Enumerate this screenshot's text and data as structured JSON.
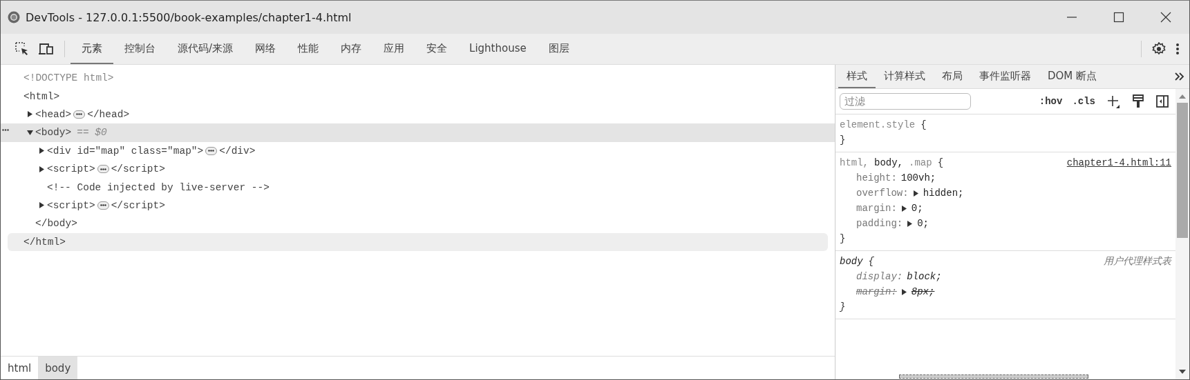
{
  "window": {
    "title": "DevTools - 127.0.0.1:5500/book-examples/chapter1-4.html"
  },
  "main_tabs": [
    {
      "label": "元素",
      "selected": true
    },
    {
      "label": "控制台",
      "selected": false
    },
    {
      "label": "源代码/来源",
      "selected": false
    },
    {
      "label": "网络",
      "selected": false
    },
    {
      "label": "性能",
      "selected": false
    },
    {
      "label": "内存",
      "selected": false
    },
    {
      "label": "应用",
      "selected": false
    },
    {
      "label": "安全",
      "selected": false
    },
    {
      "label": "Lighthouse",
      "selected": false
    },
    {
      "label": "图层",
      "selected": false
    }
  ],
  "dom_tree": [
    {
      "kind": "doctype",
      "text": "<!DOCTYPE html>"
    },
    {
      "kind": "element",
      "open": "<html>",
      "selected": false,
      "closing": "</html>",
      "closing_hovered": true,
      "children": [
        {
          "kind": "element",
          "open": "<head>",
          "close": "</head>",
          "expanded": false,
          "selected": false
        },
        {
          "kind": "element",
          "open": "<body>",
          "note": "== $0",
          "expanded": true,
          "selected": true,
          "closing": "</body>",
          "closing_hovered": false,
          "children": [
            {
              "kind": "element",
              "open": "<div id=\"map\" class=\"map\">",
              "close": "</div>",
              "expanded": false,
              "selected": false
            },
            {
              "kind": "element",
              "open": "<script>",
              "close": "</script>",
              "expanded": false,
              "selected": false
            },
            {
              "kind": "comment",
              "text": "<!-- Code injected by live-server -->"
            },
            {
              "kind": "element",
              "open": "<script>",
              "close": "</script>",
              "expanded": false,
              "selected": false
            }
          ]
        }
      ]
    }
  ],
  "breadcrumbs": [
    {
      "label": "html",
      "selected": false
    },
    {
      "label": "body",
      "selected": true
    }
  ],
  "styles_tabs": [
    {
      "label": "样式",
      "selected": true
    },
    {
      "label": "计算样式",
      "selected": false
    },
    {
      "label": "布局",
      "selected": false
    },
    {
      "label": "事件监听器",
      "selected": false
    },
    {
      "label": "DOM 断点",
      "selected": false
    }
  ],
  "filter": {
    "placeholder": "过滤"
  },
  "filter_buttons": [
    ":hov",
    ".cls"
  ],
  "rules": [
    {
      "kind": "inline",
      "selectors": [
        {
          "text": "element.style",
          "matched": false
        }
      ],
      "open": "{",
      "close": "}"
    },
    {
      "kind": "author",
      "selectors": [
        {
          "text": "html,",
          "matched": false
        },
        {
          "text": "body,",
          "matched": true
        },
        {
          "text": ".map",
          "matched": false
        }
      ],
      "open": "{",
      "close": "}",
      "source": "chapter1-4.html:11",
      "properties": [
        {
          "name": "height:",
          "value": "100vh;",
          "expandable": false,
          "overridden": false
        },
        {
          "name": "overflow:",
          "value": "hidden;",
          "expandable": true,
          "overridden": false
        },
        {
          "name": "margin:",
          "value": "0;",
          "expandable": true,
          "overridden": false
        },
        {
          "name": "padding:",
          "value": "0;",
          "expandable": true,
          "overridden": false
        }
      ]
    },
    {
      "kind": "user-agent",
      "selectors": [
        {
          "text": "body",
          "matched": true
        }
      ],
      "open": "{",
      "close": "}",
      "source": "用户代理样式表",
      "properties": [
        {
          "name": "display:",
          "value": "block;",
          "expandable": false,
          "overridden": false
        },
        {
          "name": "margin:",
          "value": "8px;",
          "expandable": true,
          "overridden": true
        }
      ]
    }
  ]
}
